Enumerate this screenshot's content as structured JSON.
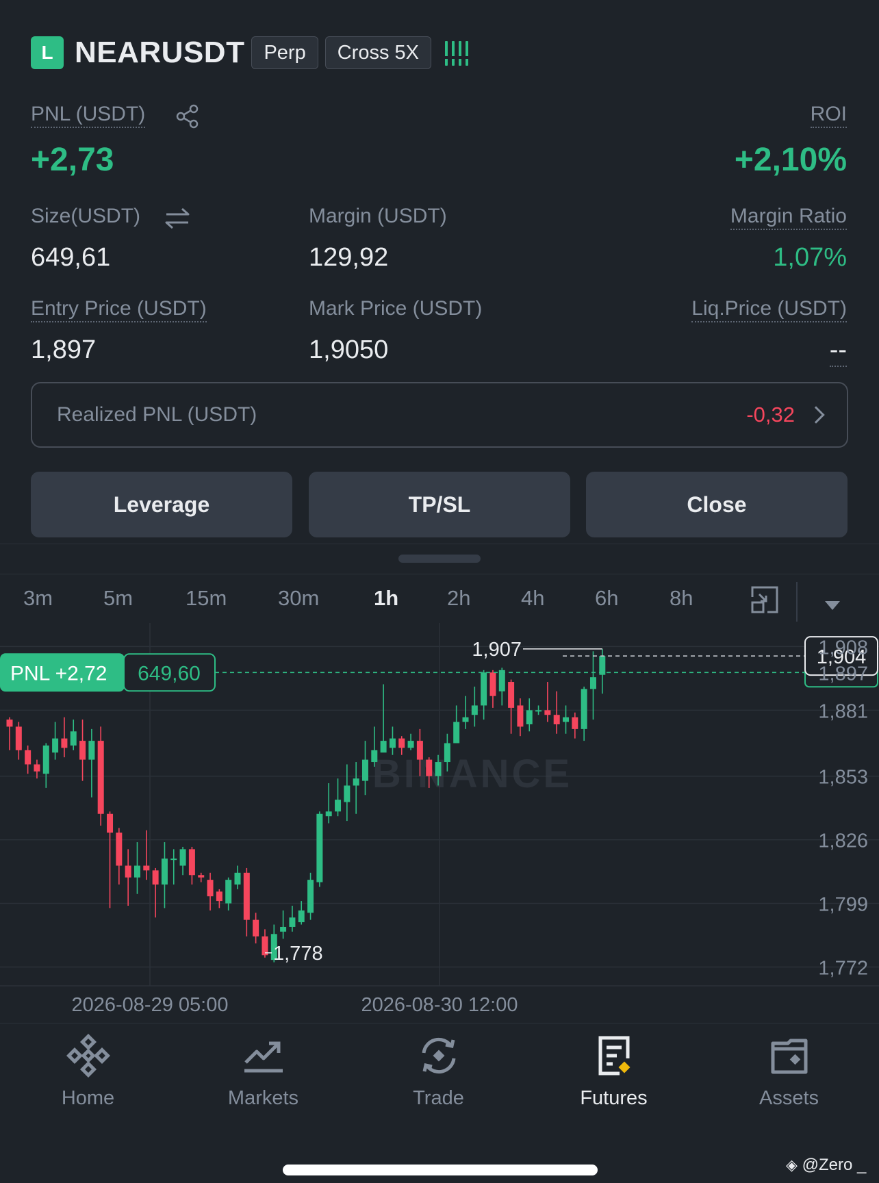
{
  "header": {
    "side_badge": "L",
    "symbol": "NEARUSDT",
    "type_tag": "Perp",
    "margin_tag": "Cross 5X",
    "risk_icon": "risk-bars-icon"
  },
  "position": {
    "pnl_label": "PNL (USDT)",
    "pnl_value": "+2,73",
    "roi_label": "ROI",
    "roi_value": "+2,10%",
    "size_label": "Size(USDT)",
    "size_value": "649,61",
    "margin_label": "Margin (USDT)",
    "margin_value": "129,92",
    "margin_ratio_label": "Margin Ratio",
    "margin_ratio_value": "1,07%",
    "entry_label": "Entry Price (USDT)",
    "entry_value": "1,897",
    "mark_label": "Mark Price (USDT)",
    "mark_value": "1,9050",
    "liq_label": "Liq.Price (USDT)",
    "liq_value": "--",
    "realized_label": "Realized PNL (USDT)",
    "realized_value": "-0,32"
  },
  "actions": {
    "leverage": "Leverage",
    "tpsl": "TP/SL",
    "close": "Close"
  },
  "timeframes": [
    "3m",
    "5m",
    "15m",
    "30m",
    "1h",
    "2h",
    "4h",
    "6h",
    "8h"
  ],
  "active_timeframe": "1h",
  "chart": {
    "watermark": "BINANCE",
    "pnl_tag_label": "PNL +2,72",
    "pnl_tag_value": "649,60",
    "current_price_label": "1,904",
    "high_label": "1,907",
    "low_label": "1,778",
    "y_ticks": [
      "1,908",
      "1,897",
      "1,881",
      "1,853",
      "1,826",
      "1,799",
      "1,772"
    ],
    "x_ticks": [
      "2026-08-29 05:00",
      "2026-08-30 12:00"
    ]
  },
  "chart_data": {
    "type": "candlestick",
    "interval": "1h",
    "ylim": [
      1.764,
      1.918
    ],
    "y_ticks": [
      1.908,
      1.881,
      1.853,
      1.826,
      1.799,
      1.772
    ],
    "x_ticks": [
      "2026-08-29 05:00",
      "2026-08-30 12:00"
    ],
    "high_marker": 1.907,
    "low_marker": 1.778,
    "current_price": 1.904,
    "entry_price": 1.897,
    "up_color": "#2ebd85",
    "down_color": "#f6465d",
    "candles": [
      [
        1.877,
        1.874,
        1.878,
        1.864
      ],
      [
        1.874,
        1.864,
        1.876,
        1.86
      ],
      [
        1.864,
        1.858,
        1.866,
        1.854
      ],
      [
        1.858,
        1.855,
        1.86,
        1.852
      ],
      [
        1.854,
        1.866,
        1.867,
        1.848
      ],
      [
        1.863,
        1.869,
        1.876,
        1.86
      ],
      [
        1.869,
        1.865,
        1.878,
        1.861
      ],
      [
        1.866,
        1.872,
        1.877,
        1.864
      ],
      [
        1.868,
        1.86,
        1.877,
        1.851
      ],
      [
        1.86,
        1.868,
        1.873,
        1.844
      ],
      [
        1.868,
        1.837,
        1.874,
        1.832
      ],
      [
        1.837,
        1.829,
        1.838,
        1.797
      ],
      [
        1.829,
        1.815,
        1.831,
        1.807
      ],
      [
        1.815,
        1.81,
        1.822,
        1.798
      ],
      [
        1.81,
        1.815,
        1.825,
        1.803
      ],
      [
        1.815,
        1.813,
        1.83,
        1.809
      ],
      [
        1.813,
        1.807,
        1.814,
        1.793
      ],
      [
        1.807,
        1.818,
        1.825,
        1.797
      ],
      [
        1.818,
        1.818,
        1.822,
        1.807
      ],
      [
        1.815,
        1.822,
        1.823,
        1.811
      ],
      [
        1.822,
        1.811,
        1.823,
        1.807
      ],
      [
        1.811,
        1.81,
        1.812,
        1.808
      ],
      [
        1.809,
        1.802,
        1.812,
        1.796
      ],
      [
        1.804,
        1.8,
        1.805,
        1.797
      ],
      [
        1.799,
        1.809,
        1.81,
        1.796
      ],
      [
        1.807,
        1.812,
        1.815,
        1.805
      ],
      [
        1.812,
        1.792,
        1.814,
        1.785
      ],
      [
        1.792,
        1.785,
        1.795,
        1.782
      ],
      [
        1.785,
        1.777,
        1.788,
        1.776
      ],
      [
        1.775,
        1.786,
        1.79,
        1.774
      ],
      [
        1.787,
        1.789,
        1.796,
        1.784
      ],
      [
        1.789,
        1.793,
        1.798,
        1.787
      ],
      [
        1.791,
        1.796,
        1.8,
        1.79
      ],
      [
        1.795,
        1.809,
        1.812,
        1.792
      ],
      [
        1.808,
        1.837,
        1.838,
        1.806
      ],
      [
        1.836,
        1.838,
        1.85,
        1.833
      ],
      [
        1.838,
        1.843,
        1.852,
        1.836
      ],
      [
        1.842,
        1.849,
        1.858,
        1.834
      ],
      [
        1.849,
        1.852,
        1.859,
        1.837
      ],
      [
        1.851,
        1.86,
        1.868,
        1.845
      ],
      [
        1.859,
        1.864,
        1.874,
        1.857
      ],
      [
        1.863,
        1.868,
        1.892,
        1.864
      ],
      [
        1.865,
        1.869,
        1.874,
        1.862
      ],
      [
        1.869,
        1.865,
        1.87,
        1.862
      ],
      [
        1.865,
        1.868,
        1.871,
        1.864
      ],
      [
        1.868,
        1.86,
        1.873,
        1.853
      ],
      [
        1.86,
        1.853,
        1.861,
        1.848
      ],
      [
        1.853,
        1.859,
        1.862,
        1.849
      ],
      [
        1.859,
        1.867,
        1.871,
        1.855
      ],
      [
        1.867,
        1.876,
        1.883,
        1.867
      ],
      [
        1.876,
        1.878,
        1.887,
        1.873
      ],
      [
        1.879,
        1.883,
        1.891,
        1.874
      ],
      [
        1.883,
        1.897,
        1.898,
        1.877
      ],
      [
        1.897,
        1.887,
        1.898,
        1.882
      ],
      [
        1.889,
        1.898,
        1.899,
        1.883
      ],
      [
        1.893,
        1.882,
        1.894,
        1.871
      ],
      [
        1.883,
        1.874,
        1.886,
        1.87
      ],
      [
        1.875,
        1.881,
        1.886,
        1.872
      ],
      [
        1.881,
        1.881,
        1.883,
        1.879
      ],
      [
        1.881,
        1.879,
        1.893,
        1.876
      ],
      [
        1.879,
        1.875,
        1.889,
        1.871
      ],
      [
        1.876,
        1.878,
        1.883,
        1.871
      ],
      [
        1.878,
        1.873,
        1.88,
        1.869
      ],
      [
        1.873,
        1.89,
        1.891,
        1.868
      ],
      [
        1.89,
        1.895,
        1.906,
        1.877
      ],
      [
        1.896,
        1.904,
        1.907,
        1.888
      ]
    ]
  },
  "nav": [
    {
      "label": "Home",
      "icon": "binance-logo-icon"
    },
    {
      "label": "Markets",
      "icon": "chart-trend-icon"
    },
    {
      "label": "Trade",
      "icon": "exchange-icon"
    },
    {
      "label": "Futures",
      "icon": "futures-doc-icon"
    },
    {
      "label": "Assets",
      "icon": "wallet-icon"
    }
  ],
  "active_nav": "Futures",
  "watermark_text": "@Zero _"
}
